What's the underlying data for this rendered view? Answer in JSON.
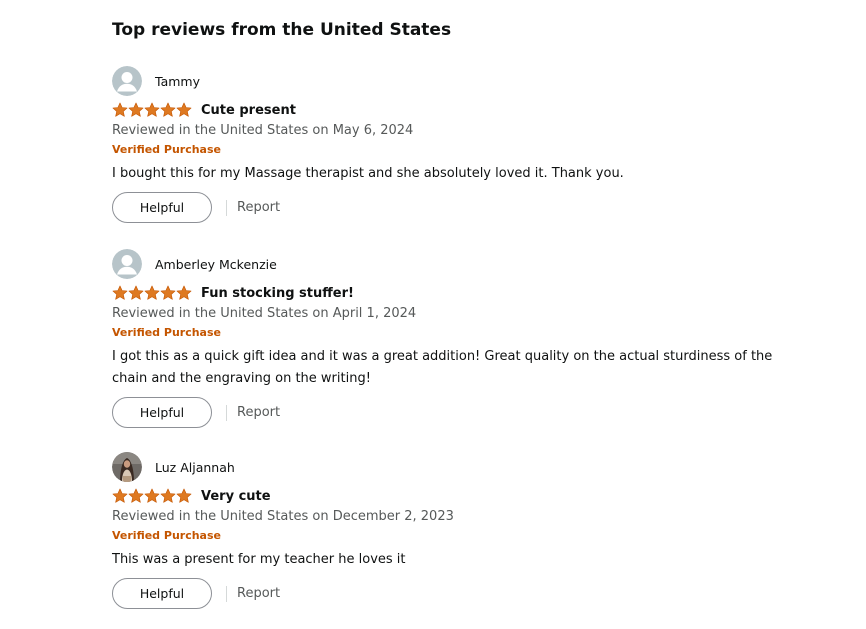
{
  "section": {
    "title": "Top reviews from the United States"
  },
  "colors": {
    "star": "#de7921",
    "verified": "#c45500",
    "muted_text": "#565959"
  },
  "reviews": [
    {
      "reviewer": "Tammy",
      "avatar_icon": "default-user-icon",
      "rating": 5,
      "title": "Cute present",
      "date": "Reviewed in the United States on May 6, 2024",
      "verified": "Verified Purchase",
      "body": "I bought this for my Massage therapist and she absolutely loved it. Thank you.",
      "helpful_label": "Helpful",
      "report_label": "Report"
    },
    {
      "reviewer": "Amberley Mckenzie",
      "avatar_icon": "default-user-icon",
      "rating": 5,
      "title": "Fun stocking stuffer!",
      "date": "Reviewed in the United States on April 1, 2024",
      "verified": "Verified Purchase",
      "body": "I got this as a quick gift idea and it was a great addition! Great quality on the actual sturdiness of the chain and the engraving on the writing!",
      "helpful_label": "Helpful",
      "report_label": "Report"
    },
    {
      "reviewer": "Luz Aljannah",
      "avatar_icon": "profile-photo",
      "rating": 5,
      "title": "Very cute",
      "date": "Reviewed in the United States on December 2, 2023",
      "verified": "Verified Purchase",
      "body": "This was a present for my teacher he loves it",
      "helpful_label": "Helpful",
      "report_label": "Report"
    }
  ]
}
